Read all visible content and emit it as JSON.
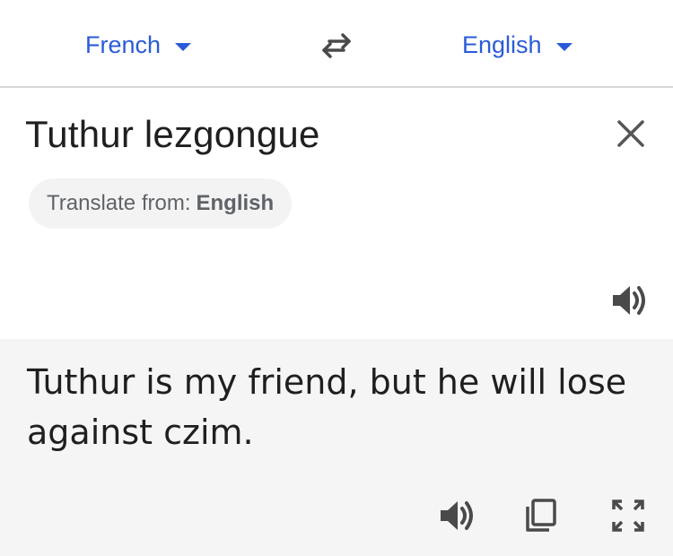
{
  "language_bar": {
    "source_language": "French",
    "target_language": "English",
    "swap_icon": "swap-arrows-icon"
  },
  "input": {
    "text": "Tuthur lezgongue",
    "clear_icon": "close-icon",
    "suggestion_prefix": "Translate from:",
    "suggestion_language": "English",
    "speak_icon": "speaker-icon"
  },
  "output": {
    "text": "Tuthur is my friend, but he will lose against czim.",
    "actions": [
      "speaker-icon",
      "copy-icon",
      "fullscreen-icon"
    ]
  },
  "colors": {
    "accent": "#2a5bd7",
    "text": "#1f1f1f",
    "muted": "#5f6368",
    "output_bg": "#f5f5f5",
    "chip_bg": "#f3f3f3",
    "divider": "#d6d6d6",
    "icon": "#4a4a4a"
  }
}
